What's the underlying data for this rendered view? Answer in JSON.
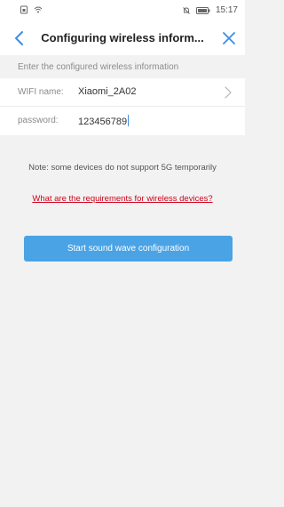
{
  "status_bar": {
    "time": "15:17"
  },
  "header": {
    "title": "Configuring wireless inform...",
    "back_icon": "chevron-left-icon",
    "close_icon": "close-icon"
  },
  "form": {
    "hint": "Enter the configured wireless information",
    "wifi_label": "WIFI name:",
    "wifi_value": "Xiaomi_2A02",
    "password_label": "password:",
    "password_value": "123456789"
  },
  "note": "Note: some devices do not support 5G temporarily",
  "requirements_link": "What are the requirements for wireless devices?",
  "start_button": "Start sound wave configuration",
  "colors": {
    "accent": "#4aa3e5",
    "link": "#d0021b",
    "background": "#f2f2f2"
  }
}
